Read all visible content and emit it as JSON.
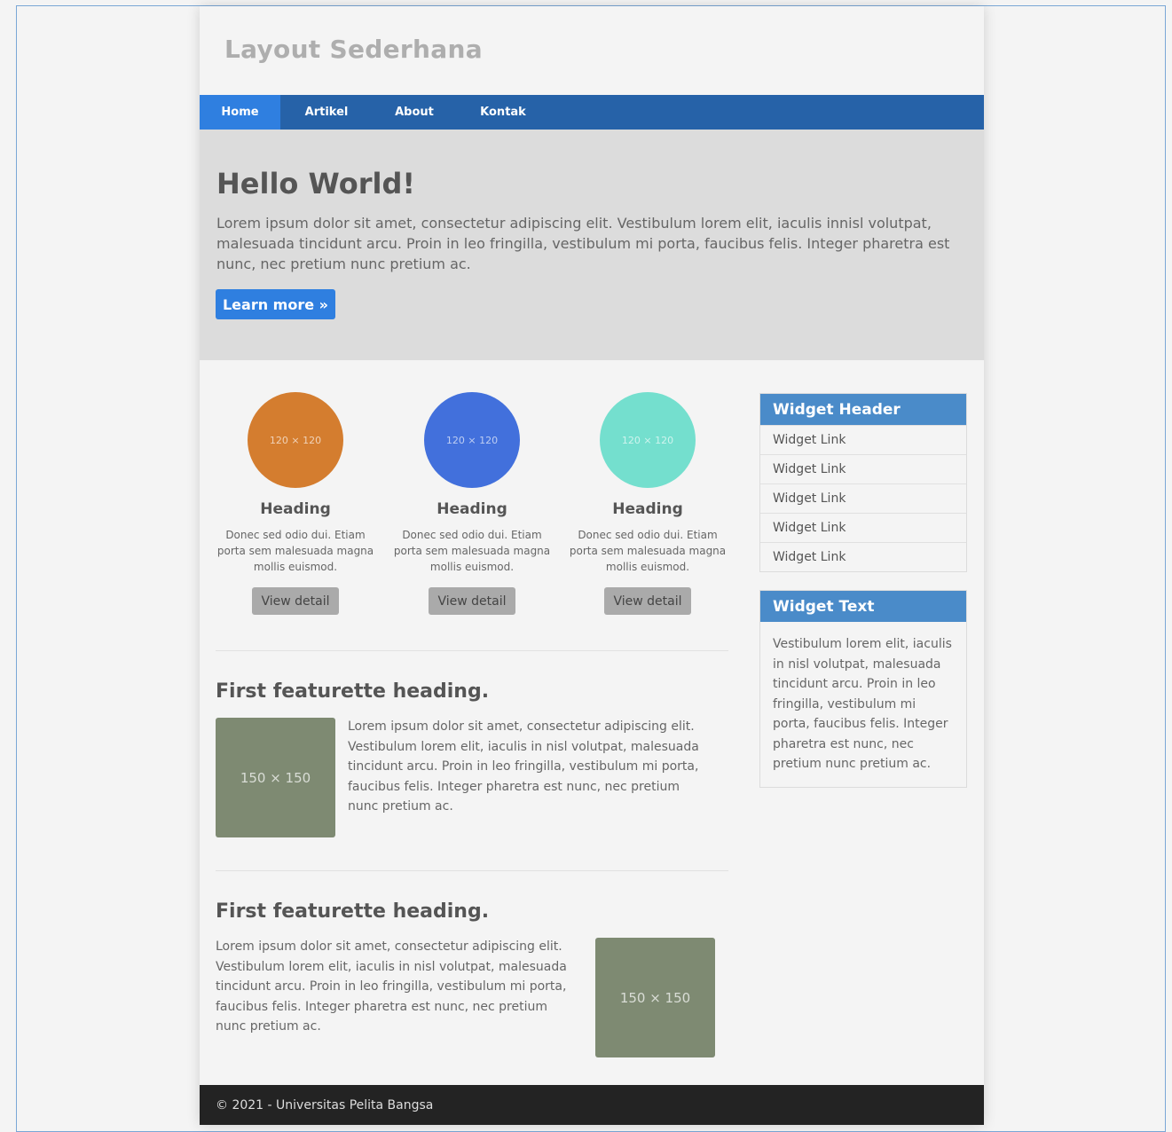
{
  "header": {
    "title": "Layout Sederhana"
  },
  "nav": {
    "items": [
      "Home",
      "Artikel",
      "About",
      "Kontak"
    ]
  },
  "hero": {
    "title": "Hello World!",
    "text": "Lorem ipsum dolor sit amet, consectetur adipiscing elit. Vestibulum lorem elit, iaculis innisl volutpat, malesuada tincidunt arcu. Proin in leo fringilla, vestibulum mi porta, faucibus felis. Integer pharetra est nunc, nec pretium nunc pretium ac.",
    "button": "Learn more »"
  },
  "cards": [
    {
      "placeholder": "120 × 120",
      "color": "#d47d2f",
      "heading": "Heading",
      "text": "Donec sed odio dui. Etiam porta sem malesuada magna mollis euismod.",
      "button": "View detail"
    },
    {
      "placeholder": "120 × 120",
      "color": "#4270dc",
      "heading": "Heading",
      "text": "Donec sed odio dui. Etiam porta sem malesuada magna mollis euismod.",
      "button": "View detail"
    },
    {
      "placeholder": "120 × 120",
      "color": "#74dfce",
      "heading": "Heading",
      "text": "Donec sed odio dui. Etiam porta sem malesuada magna mollis euismod.",
      "button": "View detail"
    }
  ],
  "featurettes": [
    {
      "heading": "First featurette heading.",
      "placeholder": "150 × 150",
      "text": "Lorem ipsum dolor sit amet, consectetur adipiscing elit. Vestibulum lorem elit, iaculis in nisl volutpat, malesuada tincidunt arcu. Proin in leo fringilla, vestibulum mi porta, faucibus felis. Integer pharetra est nunc, nec pretium nunc pretium ac."
    },
    {
      "heading": "First featurette heading.",
      "placeholder": "150 × 150",
      "text": "Lorem ipsum dolor sit amet, consectetur adipiscing elit. Vestibulum lorem elit, iaculis in nisl volutpat, malesuada tincidunt arcu. Proin in leo fringilla, vestibulum mi porta, faucibus felis. Integer pharetra est nunc, nec pretium nunc pretium ac."
    }
  ],
  "sidebar": {
    "widget_links": {
      "header": "Widget Header",
      "links": [
        "Widget Link",
        "Widget Link",
        "Widget Link",
        "Widget Link",
        "Widget Link"
      ]
    },
    "widget_text": {
      "header": "Widget Text",
      "text": "Vestibulum lorem elit, iaculis in nisl volutpat, malesuada tincidunt arcu. Proin in leo fringilla, vestibulum mi porta, faucibus felis. Integer pharetra est nunc, nec pretium nunc pretium ac."
    }
  },
  "footer": {
    "text": "© 2021 - Universitas Pelita Bangsa"
  },
  "colors": {
    "nav": "#2662a8",
    "nav_active": "#2f7fe0",
    "primary_button": "#2f7fe0",
    "widget_header": "#4a8bc9",
    "placeholder": "#7e8a72",
    "footer": "#232323"
  }
}
